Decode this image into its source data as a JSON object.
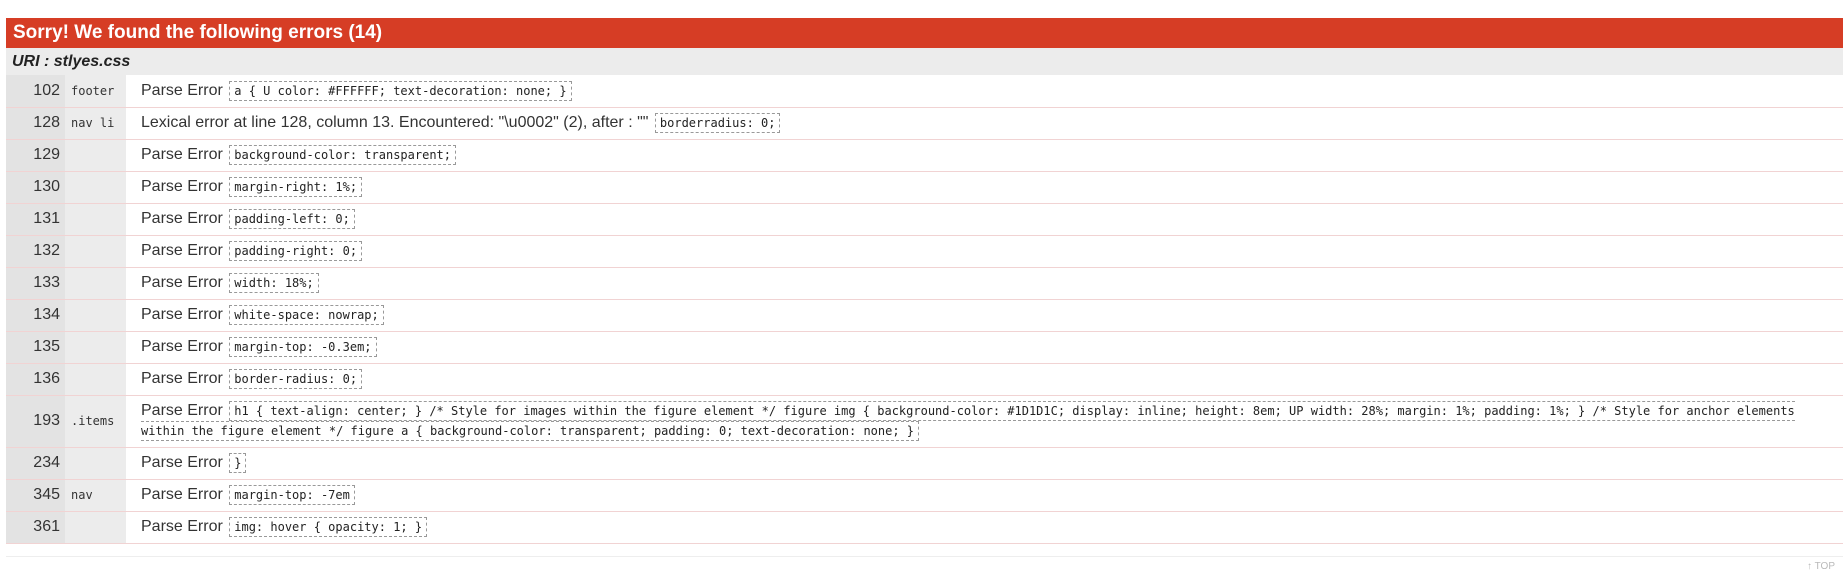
{
  "panel": {
    "title": "Sorry! We found the following errors (14)",
    "header_color": "#d63d25"
  },
  "uri": {
    "label": "URI : stlyes.css"
  },
  "errors": [
    {
      "line": "102",
      "context": "footer",
      "message": "Parse Error",
      "skipped": "a { U color: #FFFFFF; text-decoration: none; }"
    },
    {
      "line": "128",
      "context": "nav li",
      "message": "Lexical error at line 128, column 13. Encountered: \"\\u0002\" (2), after : \"\"",
      "skipped": "border\u0002radius: 0;"
    },
    {
      "line": "129",
      "context": "",
      "message": "Parse Error",
      "skipped": "background-color: transparent;"
    },
    {
      "line": "130",
      "context": "",
      "message": "Parse Error",
      "skipped": "margin-right: 1%;"
    },
    {
      "line": "131",
      "context": "",
      "message": "Parse Error",
      "skipped": "padding-left: 0;"
    },
    {
      "line": "132",
      "context": "",
      "message": "Parse Error",
      "skipped": "padding-right: 0;"
    },
    {
      "line": "133",
      "context": "",
      "message": "Parse Error",
      "skipped": "width: 18%;"
    },
    {
      "line": "134",
      "context": "",
      "message": "Parse Error",
      "skipped": "white-space: nowrap;"
    },
    {
      "line": "135",
      "context": "",
      "message": "Parse Error",
      "skipped": "margin-top: -0.3em;"
    },
    {
      "line": "136",
      "context": "",
      "message": "Parse Error",
      "skipped": "border-radius: 0;"
    },
    {
      "line": "193",
      "context": ".items",
      "message": "Parse Error",
      "skipped": "h1 { text-align: center; } /* Style for images within the figure element */ figure img { background-color: #1D1D1C; display: inline; height: 8em; UP width: 28%; margin: 1%; padding: 1%; } /* Style for anchor elements within the figure element */ figure a { background-color: transparent; padding: 0; text-decoration: none; }"
    },
    {
      "line": "234",
      "context": "",
      "message": "Parse Error",
      "skipped": "}"
    },
    {
      "line": "345",
      "context": "nav",
      "message": "Parse Error",
      "skipped": "margin-top: -7em"
    },
    {
      "line": "361",
      "context": "",
      "message": "Parse Error",
      "skipped": "img: hover { opacity: 1; }"
    }
  ],
  "footer": {
    "top_link": "↑ TOP"
  }
}
